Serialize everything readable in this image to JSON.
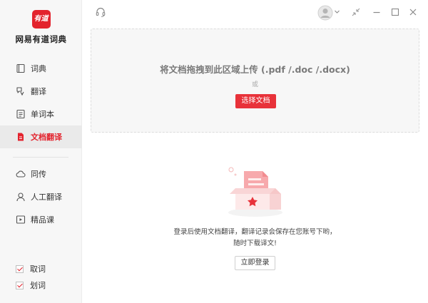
{
  "app": {
    "logo_text": "有道",
    "name": "网易有道词典"
  },
  "sidebar": {
    "items": [
      {
        "label": "词典",
        "icon": "book-icon"
      },
      {
        "label": "翻译",
        "icon": "translate-icon"
      },
      {
        "label": "单词本",
        "icon": "wordbook-icon"
      },
      {
        "label": "文档翻译",
        "icon": "document-icon",
        "active": true
      },
      {
        "label": "同传",
        "icon": "cloud-icon"
      },
      {
        "label": "人工翻译",
        "icon": "person-icon"
      },
      {
        "label": "精品课",
        "icon": "video-icon"
      }
    ],
    "checks": [
      {
        "label": "取词",
        "checked": true
      },
      {
        "label": "划词",
        "checked": true
      }
    ]
  },
  "upload": {
    "title": "将文档拖拽到此区域上传 (.pdf /.doc /.docx)",
    "or": "或",
    "choose_button": "选择文档"
  },
  "login": {
    "line1": "登录后使用文档翻译，翻译记录会保存在您账号下哟，",
    "line2": "随时下载译文!",
    "button": "立即登录"
  },
  "colors": {
    "accent": "#e3232d",
    "sidebar_bg": "#f7f7f7",
    "upload_bg": "#f7f7f7"
  }
}
